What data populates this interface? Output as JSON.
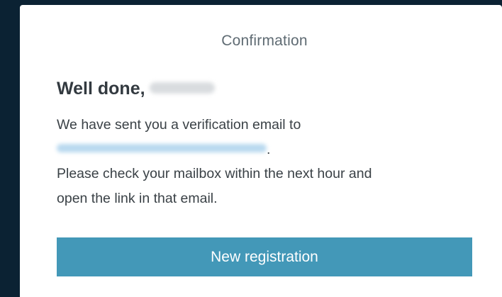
{
  "dialog": {
    "title": "Confirmation",
    "greeting_prefix": "Well done,",
    "greeting_suffix": "",
    "message_line1": "We have sent you a verification email to",
    "email_suffix": ".",
    "message_line3": "Please check your mailbox within the next hour and",
    "message_line4": "open the link in that email.",
    "button_label": "New registration"
  },
  "colors": {
    "button_bg": "#4398b8",
    "button_text": "#ffffff",
    "title_text": "#5f6b73",
    "body_text": "#3a4146",
    "backdrop": "#0b2233"
  }
}
